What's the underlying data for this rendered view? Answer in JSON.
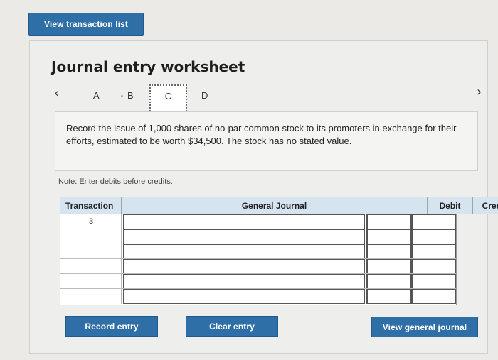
{
  "header": {
    "view_transaction_list": "View transaction list"
  },
  "worksheet": {
    "title": "Journal entry worksheet",
    "tabs": [
      {
        "label": "A",
        "active": false
      },
      {
        "label": "B",
        "active": false
      },
      {
        "label": "C",
        "active": true
      },
      {
        "label": "D",
        "active": false
      }
    ],
    "prev_icon": "chevron-left-icon",
    "next_icon": "chevron-right-icon",
    "question": "Record the issue of 1,000 shares of no-par common stock to its promoters in exchange for their efforts, estimated to be worth $34,500. The stock has no stated value.",
    "note": "Note: Enter debits before credits."
  },
  "journal": {
    "headers": {
      "transaction": "Transaction",
      "general_journal": "General Journal",
      "debit": "Debit",
      "credit": "Credit"
    },
    "rows": [
      {
        "transaction": "3",
        "account": "",
        "debit": "",
        "credit": ""
      },
      {
        "transaction": "",
        "account": "",
        "debit": "",
        "credit": ""
      },
      {
        "transaction": "",
        "account": "",
        "debit": "",
        "credit": ""
      },
      {
        "transaction": "",
        "account": "",
        "debit": "",
        "credit": ""
      },
      {
        "transaction": "",
        "account": "",
        "debit": "",
        "credit": ""
      },
      {
        "transaction": "",
        "account": "",
        "debit": "",
        "credit": ""
      }
    ]
  },
  "actions": {
    "record_entry": "Record entry",
    "clear_entry": "Clear entry",
    "view_general_journal": "View general journal"
  },
  "colors": {
    "button": "#2f6fa7",
    "header_bg": "#d6e4f0"
  }
}
